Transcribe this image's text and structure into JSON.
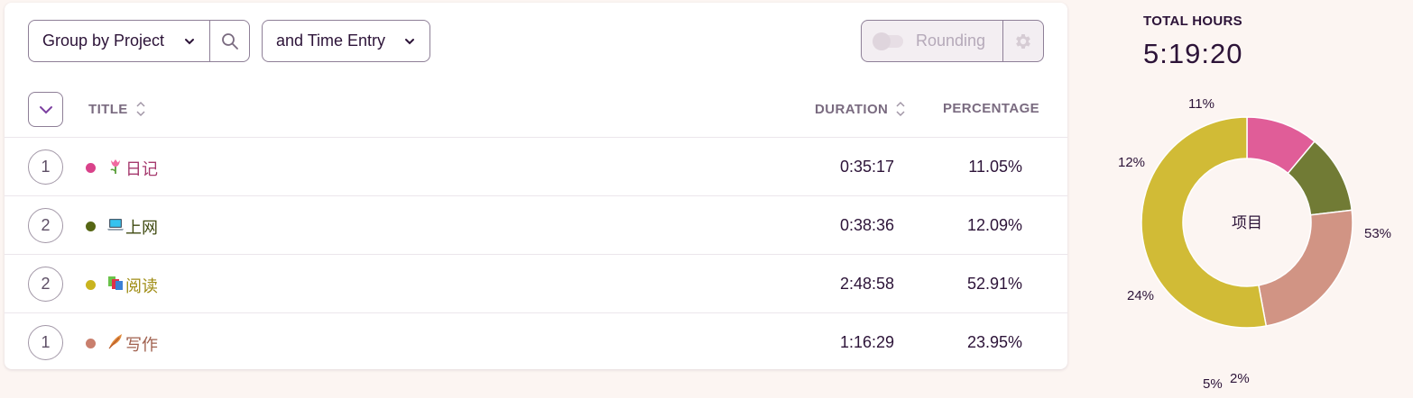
{
  "toolbar": {
    "group_by_label": "Group by Project",
    "sub_group_label": "and Time Entry",
    "rounding_label": "Rounding"
  },
  "table": {
    "headers": {
      "title": "TITLE",
      "duration": "DURATION",
      "percentage": "PERCENTAGE"
    },
    "rows": [
      {
        "count": "1",
        "emoji": "tulip",
        "title": "日记",
        "duration": "0:35:17",
        "percentage": "11.05%",
        "color": "#d9428a",
        "title_color": "#a63a6e"
      },
      {
        "count": "2",
        "emoji": "laptop",
        "title": "上网",
        "duration": "0:38:36",
        "percentage": "12.09%",
        "color": "#566614",
        "title_color": "#3f4a10"
      },
      {
        "count": "2",
        "emoji": "books",
        "title": "阅读",
        "duration": "2:48:58",
        "percentage": "52.91%",
        "color": "#c9b41f",
        "title_color": "#9f8c14"
      },
      {
        "count": "1",
        "emoji": "feather",
        "title": "写作",
        "duration": "1:16:29",
        "percentage": "23.95%",
        "color": "#c97f6d",
        "title_color": "#a0604e"
      }
    ]
  },
  "summary": {
    "total_label": "TOTAL HOURS",
    "total_value": "5:19:20"
  },
  "chart_data": {
    "type": "pie",
    "center_label": "项目",
    "series": [
      {
        "name": "日记",
        "value": 11.05,
        "color": "#e05d98"
      },
      {
        "name": "上网",
        "value": 12.09,
        "color": "#717b35"
      },
      {
        "name": "写作",
        "value": 23.95,
        "color": "#d19484"
      },
      {
        "name": "阅读",
        "value": 52.91,
        "color": "#d1bb36"
      }
    ],
    "slice_labels": [
      "11%",
      "12%",
      "24%",
      "53%"
    ],
    "extra_labels": [
      "5%",
      "2%"
    ]
  }
}
